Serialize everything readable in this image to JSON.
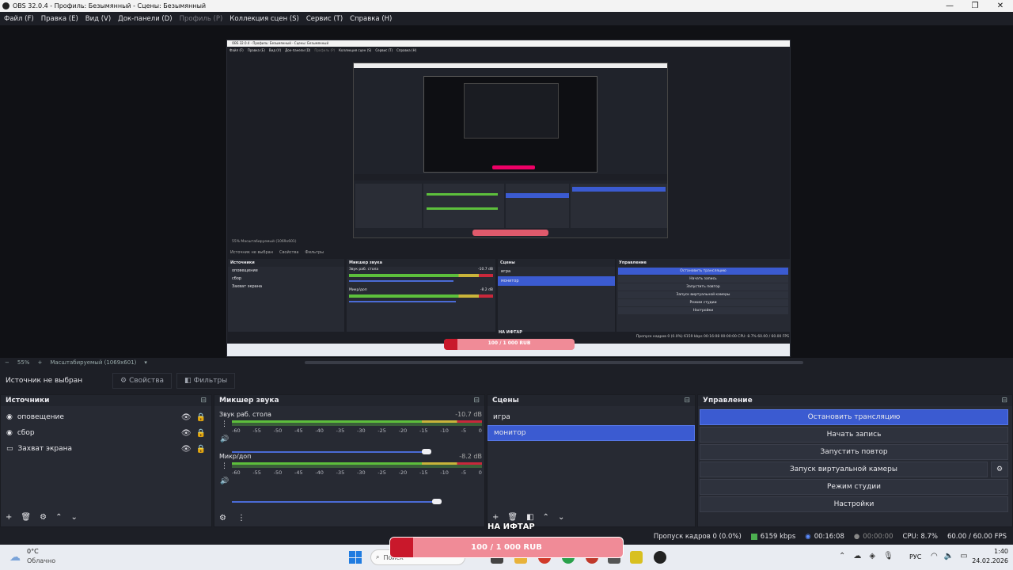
{
  "window": {
    "title": "OBS 32.0.4 - Профиль: Безымянный - Сцены: Безымянный",
    "controls": [
      "—",
      "❐",
      "✕"
    ]
  },
  "menu": [
    "Файл (F)",
    "Правка (E)",
    "Вид (V)",
    "Док-панели (D)",
    "Профиль (P)",
    "Коллекция сцен (S)",
    "Сервис (T)",
    "Справка (H)"
  ],
  "menu_disabled_index": 4,
  "zoom": {
    "minus": "−",
    "value": "55%",
    "plus": "+",
    "mode": "Масштабируемый (1069x601)"
  },
  "nested_preview": {
    "title": "OBS 32.0.4 - Профиль: Безымянный - Сцены: Безымянный",
    "menu": [
      "Файл (F)",
      "Правка (E)",
      "Вид (V)",
      "Док-панели (D)",
      "Профиль (P)",
      "Коллекция сцен (S)",
      "Сервис (T)",
      "Справка (H)"
    ],
    "zoom_text": "55%    Масштабируемый (1069x601)",
    "no_source": "Источник не выбран",
    "props": "Свойства",
    "filters": "Фильтры",
    "sources_title": "Источники",
    "mixer_title": "Микшер звука",
    "scenes_title": "Сцены",
    "controls_title": "Управление",
    "sources": [
      "оповещение",
      "сбор",
      "Захват экрана"
    ],
    "scenes": [
      "игра",
      "монитор"
    ],
    "controls": [
      "Остановить трансляцию",
      "Начать запись",
      "Запустить повтор",
      "Запуск виртуальной камеры",
      "Режим студии",
      "Настройки"
    ],
    "mixer": [
      {
        "name": "Звук раб. стола",
        "db": "-10.7 dB"
      },
      {
        "name": "Микр/доп",
        "db": "-8.2 dB"
      }
    ],
    "donate_title": "НА ИФТАР",
    "donate_amount": "100 / 1 000 RUB",
    "status": "Пропуск кадров 0 (0.0%)   6159 kbps   00:16:08   00:00:00   CPU: 8.7%   60.00 / 60.00 FPS"
  },
  "properties_bar": {
    "no_source": "Источник не выбран",
    "properties": "Свойства",
    "filters": "Фильтры"
  },
  "sources": {
    "title": "Источники",
    "items": [
      {
        "label": "оповещение",
        "icon": "globe-icon"
      },
      {
        "label": "сбор",
        "icon": "globe-icon"
      },
      {
        "label": "Захват экрана",
        "icon": "monitor-icon"
      }
    ],
    "toolbar": [
      "+",
      "🗑",
      "⚙",
      "⌃",
      "⌄"
    ]
  },
  "mixer": {
    "title": "Микшер звука",
    "tracks": [
      {
        "name": "Звук раб. стола",
        "db": "-10.7 dB",
        "volume_percent": 78
      },
      {
        "name": "Микр/доп",
        "db": "-8.2 dB",
        "volume_percent": 82
      }
    ],
    "ticks": [
      "-60",
      "-55",
      "-50",
      "-45",
      "-40",
      "-35",
      "-30",
      "-25",
      "-20",
      "-15",
      "-10",
      "-5",
      "0"
    ]
  },
  "scenes": {
    "title": "Сцены",
    "items": [
      "игра",
      "монитор"
    ],
    "selected_index": 1
  },
  "controls": {
    "title": "Управление",
    "stop_stream": "Остановить трансляцию",
    "start_record": "Начать запись",
    "start_replay": "Запустить повтор",
    "virtual_cam": "Запуск виртуальной камеры",
    "studio_mode": "Режим студии",
    "settings": "Настройки"
  },
  "donation": {
    "title": "НА ИФТАР",
    "amount": "100 / 1 000 RUB",
    "progress_fraction": 0.1
  },
  "status": {
    "dropped": "Пропуск кадров 0 (0.0%)",
    "bitrate": "6159 kbps",
    "stream_time": "00:16:08",
    "record_time": "00:00:00",
    "cpu": "CPU: 8.7%",
    "fps": "60.00 / 60.00 FPS"
  },
  "taskbar": {
    "weather_temp": "0°C",
    "weather_desc": "Облачно",
    "search": "Поиск",
    "lang": "РУС",
    "time": "1:40",
    "date": "24.02.2026"
  },
  "colors": {
    "accent": "#3b5bd1",
    "meter_green": "#5dbf3c",
    "meter_yellow": "#c9b43a",
    "meter_red": "#c8283b",
    "donate_red": "#c9182b",
    "donate_pink": "#f08b97"
  }
}
